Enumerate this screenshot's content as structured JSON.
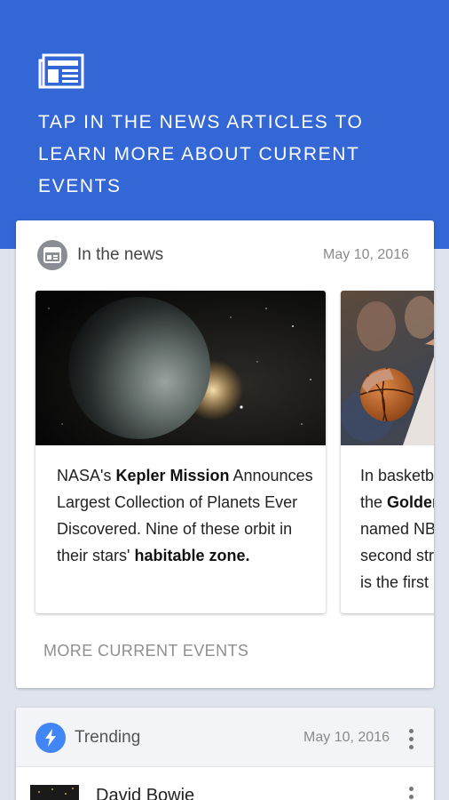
{
  "hero": {
    "icon": "newspaper-icon",
    "text": "TAP IN THE NEWS ARTICLES TO LEARN MORE ABOUT CURRENT EVENTS",
    "bg_color": "#3367d6"
  },
  "news_card": {
    "icon": "calendar-news-icon",
    "title": "In the news",
    "date": "May 10, 2016",
    "articles": [
      {
        "image": "planet-image",
        "t1": "NASA's ",
        "b1": "Kepler Mission",
        "t2": " Announces Largest Collection of Planets Ever Discovered. Nine of these orbit in their stars' ",
        "b2": "habitable zone."
      },
      {
        "image": "basketball-image",
        "l1": "In basketbal",
        "l2a": "the ",
        "l2b": "Golden",
        "l3": "named NBA",
        "l4": "second stra",
        "l5": "is the first p"
      }
    ],
    "more_label": "MORE CURRENT EVENTS"
  },
  "trending_card": {
    "icon": "lightning-icon",
    "title": "Trending",
    "date": "May 10, 2016",
    "items": [
      {
        "name": "David Bowie"
      }
    ]
  }
}
